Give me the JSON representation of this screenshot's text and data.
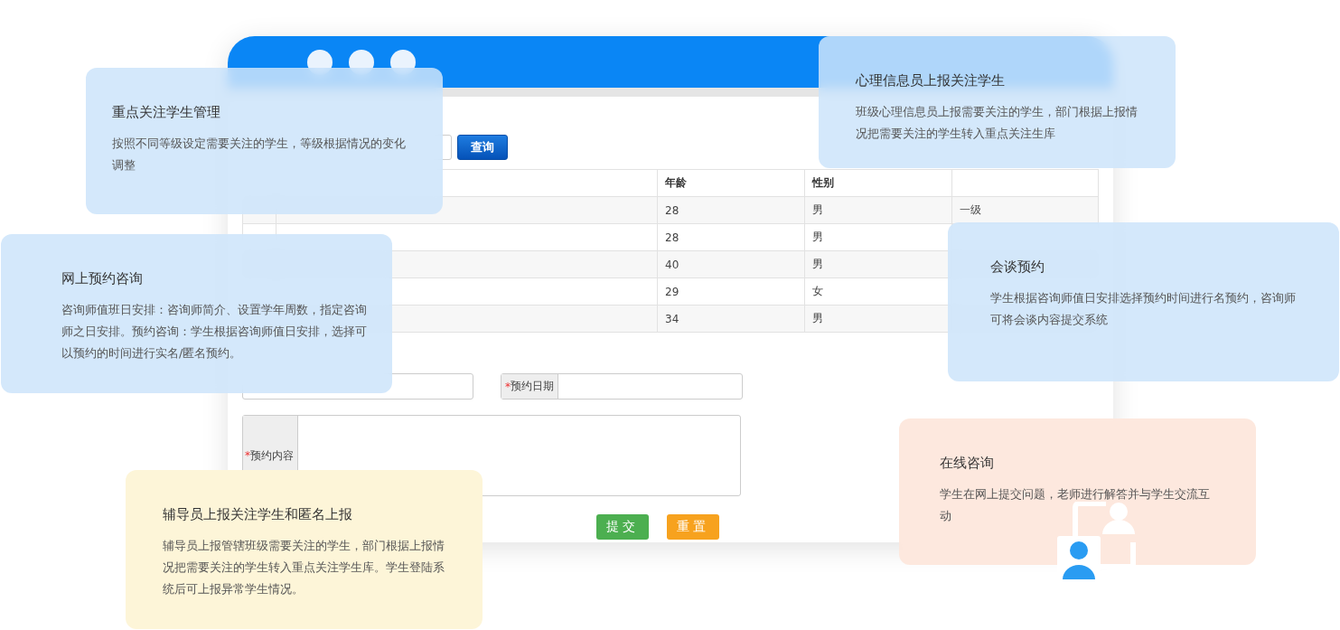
{
  "app_window": {
    "search_button": "查询",
    "table": {
      "columns": [
        "年龄",
        "性别"
      ],
      "rows": [
        {
          "age": "28",
          "gender": "男",
          "level": "一级"
        },
        {
          "age": "28",
          "gender": "男"
        },
        {
          "age": "40",
          "gender": "男"
        },
        {
          "age": "29",
          "gender": "女"
        },
        {
          "age": "34",
          "gender": "男"
        }
      ]
    },
    "form": {
      "date_label": "预约日期",
      "content_label": "预约内容",
      "required_mark": "*",
      "submit": "提交",
      "reset": "重置"
    }
  },
  "cards": [
    {
      "kind": "blue",
      "title": "重点关注学生管理",
      "text": "按照不同等级设定需要关注的学生，等级根据情况的变化调整"
    },
    {
      "kind": "blue",
      "title": "网上预约咨询",
      "text": "咨询师值班日安排：咨询师简介、设置学年周数，指定咨询师之日安排。预约咨询：学生根据咨询师值日安排，选择可以预约的时间进行实名/匿名预约。"
    },
    {
      "kind": "yellow",
      "title": "辅导员上报关注学生和匿名上报",
      "text": "辅导员上报管辖班级需要关注的学生，部门根据上报情况把需要关注的学生转入重点关注学生库。学生登陆系统后可上报异常学生情况。"
    },
    {
      "kind": "blue",
      "title": "心理信息员上报关注学生",
      "text": "班级心理信息员上报需要关注的学生，部门根据上报情况把需要关注的学生转入重点关注生库"
    },
    {
      "kind": "blue",
      "title": "会谈预约",
      "text": "学生根据咨询师值日安排选择预约时间进行名预约，咨询师可将会谈内容提交系统"
    },
    {
      "kind": "peach",
      "title": "在线咨询",
      "text": "学生在网上提交问题，老师进行解答并与学生交流互动"
    }
  ]
}
